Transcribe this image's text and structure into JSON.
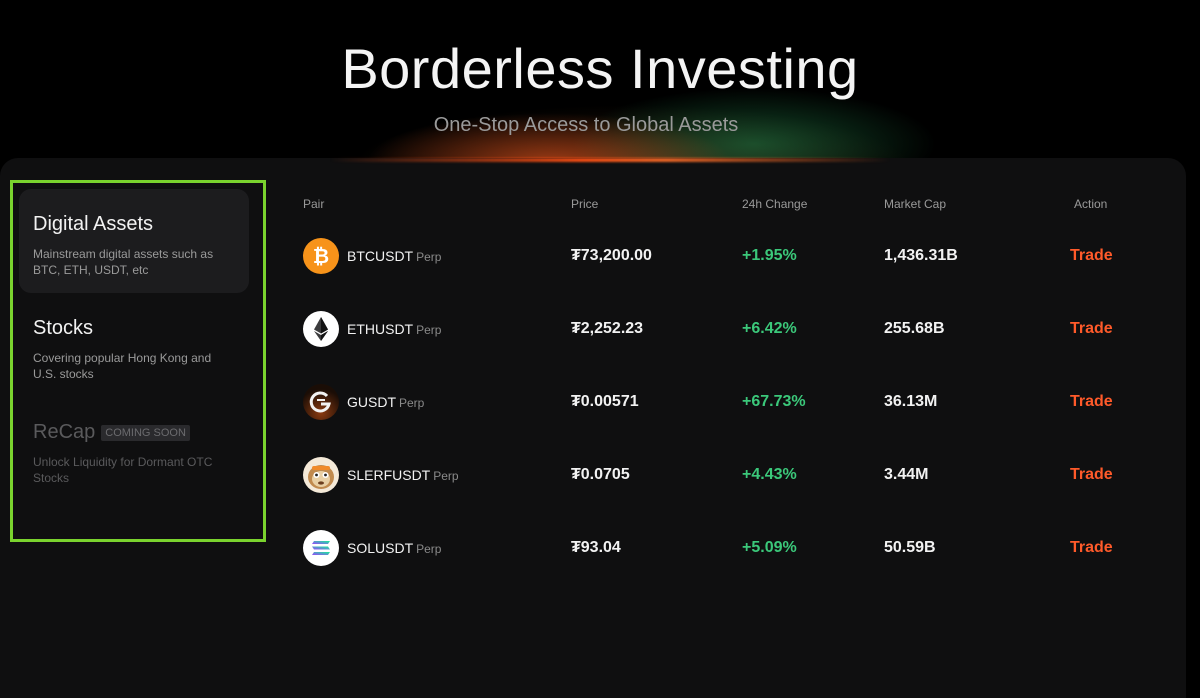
{
  "hero": {
    "title": "Borderless Investing",
    "subtitle": "One-Stop Access to Global Assets"
  },
  "categories": [
    {
      "title": "Digital Assets",
      "desc": "Mainstream digital assets such as BTC, ETH, USDT, etc",
      "active": true
    },
    {
      "title": "Stocks",
      "desc": "Covering popular Hong Kong and U.S. stocks",
      "active": false
    },
    {
      "title": "ReCap",
      "badge": "COMING SOON",
      "desc": "Unlock Liquidity for Dormant OTC Stocks",
      "disabled": true
    }
  ],
  "table": {
    "headers": {
      "pair": "Pair",
      "price": "Price",
      "change": "24h Change",
      "mcap": "Market Cap",
      "action": "Action"
    },
    "rows": [
      {
        "pair": "BTCUSDT",
        "suffix": "Perp",
        "price": "₮73,200.00",
        "change": "+1.95%",
        "mcap": "1,436.31B",
        "action": "Trade",
        "icon": "bitcoin-icon"
      },
      {
        "pair": "ETHUSDT",
        "suffix": "Perp",
        "price": "₮2,252.23",
        "change": "+6.42%",
        "mcap": "255.68B",
        "action": "Trade",
        "icon": "ethereum-icon"
      },
      {
        "pair": "GUSDT",
        "suffix": "Perp",
        "price": "₮0.00571",
        "change": "+67.73%",
        "mcap": "36.13M",
        "action": "Trade",
        "icon": "g-token-icon"
      },
      {
        "pair": "SLERFUSDT",
        "suffix": "Perp",
        "price": "₮0.0705",
        "change": "+4.43%",
        "mcap": "3.44M",
        "action": "Trade",
        "icon": "slerf-sloth-icon"
      },
      {
        "pair": "SOLUSDT",
        "suffix": "Perp",
        "price": "₮93.04",
        "change": "+5.09%",
        "mcap": "50.59B",
        "action": "Trade",
        "icon": "solana-icon"
      }
    ]
  },
  "colors": {
    "accent_trade": "#ff5a2a",
    "positive": "#3bc87a",
    "selection_outline": "#7ad32e",
    "bitcoin": "#f7931a"
  }
}
